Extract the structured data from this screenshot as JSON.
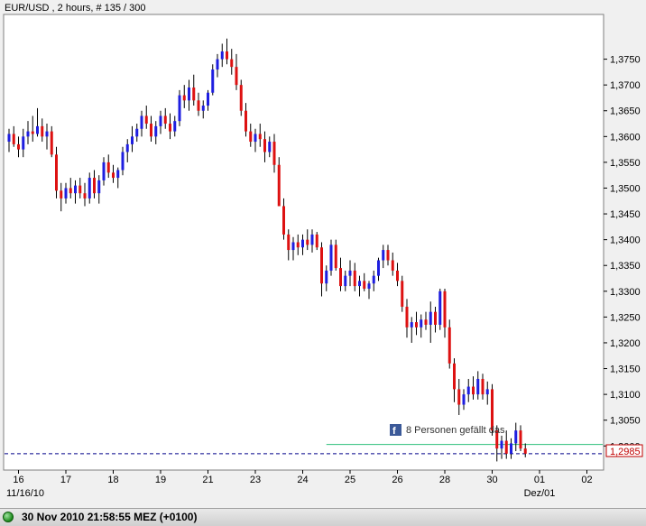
{
  "chart_data": {
    "type": "candlestick",
    "title": "EUR/USD , 2 hours, # 135 / 300",
    "y_ticks": [
      "1,2985",
      "1,3000",
      "1,3050",
      "1,3100",
      "1,3150",
      "1,3200",
      "1,3250",
      "1,3300",
      "1,3350",
      "1,3400",
      "1,3450",
      "1,3500",
      "1,3550",
      "1,3600",
      "1,3650",
      "1,3700",
      "1,3750"
    ],
    "ylim": [
      1.2955,
      1.3835
    ],
    "x_ticks": [
      {
        "label": "16",
        "bar": 2
      },
      {
        "label": "17",
        "bar": 12
      },
      {
        "label": "18",
        "bar": 22
      },
      {
        "label": "19",
        "bar": 32
      },
      {
        "label": "21",
        "bar": 42
      },
      {
        "label": "23",
        "bar": 52
      },
      {
        "label": "24",
        "bar": 62
      },
      {
        "label": "25",
        "bar": 72
      },
      {
        "label": "26",
        "bar": 82
      },
      {
        "label": "28",
        "bar": 92
      },
      {
        "label": "30",
        "bar": 102
      },
      {
        "label": "01",
        "bar": 112
      },
      {
        "label": "02",
        "bar": 122
      }
    ],
    "x_sub_labels": [
      "11/16/10",
      "Dez/01"
    ],
    "last_price": 1.2985,
    "last_price_label": "1,2985",
    "hline": {
      "value": 1.3003,
      "from_bar": 67,
      "color": "#2bbf7a"
    },
    "colors": {
      "up": "#1e1ee0",
      "down": "#dd1111",
      "wick": "#000000",
      "grid_dash": "#00008b",
      "last_label": "#c00000"
    },
    "candles": [
      [
        1.359,
        1.3615,
        1.357,
        1.3605
      ],
      [
        1.3605,
        1.362,
        1.358,
        1.3585
      ],
      [
        1.3585,
        1.36,
        1.356,
        1.3575
      ],
      [
        1.3575,
        1.3615,
        1.356,
        1.36
      ],
      [
        1.36,
        1.363,
        1.3585,
        1.361
      ],
      [
        1.361,
        1.364,
        1.359,
        1.3605
      ],
      [
        1.3605,
        1.3655,
        1.36,
        1.362
      ],
      [
        1.362,
        1.3635,
        1.359,
        1.36
      ],
      [
        1.36,
        1.3625,
        1.3575,
        1.361
      ],
      [
        1.361,
        1.362,
        1.356,
        1.3565
      ],
      [
        1.3565,
        1.358,
        1.348,
        1.3495
      ],
      [
        1.3495,
        1.351,
        1.3455,
        1.348
      ],
      [
        1.348,
        1.351,
        1.347,
        1.35
      ],
      [
        1.35,
        1.352,
        1.348,
        1.349
      ],
      [
        1.349,
        1.3515,
        1.347,
        1.3505
      ],
      [
        1.3505,
        1.352,
        1.348,
        1.349
      ],
      [
        1.349,
        1.351,
        1.3465,
        1.348
      ],
      [
        1.348,
        1.353,
        1.347,
        1.352
      ],
      [
        1.352,
        1.3535,
        1.348,
        1.349
      ],
      [
        1.349,
        1.3525,
        1.347,
        1.3515
      ],
      [
        1.3515,
        1.356,
        1.3505,
        1.355
      ],
      [
        1.355,
        1.3565,
        1.352,
        1.353
      ],
      [
        1.353,
        1.3545,
        1.351,
        1.352
      ],
      [
        1.352,
        1.354,
        1.35,
        1.3535
      ],
      [
        1.3535,
        1.358,
        1.3525,
        1.357
      ],
      [
        1.357,
        1.3595,
        1.355,
        1.3585
      ],
      [
        1.3585,
        1.362,
        1.357,
        1.36
      ],
      [
        1.36,
        1.3625,
        1.359,
        1.3615
      ],
      [
        1.3615,
        1.365,
        1.36,
        1.364
      ],
      [
        1.364,
        1.366,
        1.3615,
        1.3625
      ],
      [
        1.3625,
        1.364,
        1.359,
        1.36
      ],
      [
        1.36,
        1.363,
        1.3585,
        1.362
      ],
      [
        1.362,
        1.365,
        1.3605,
        1.364
      ],
      [
        1.364,
        1.3655,
        1.3615,
        1.3625
      ],
      [
        1.3625,
        1.3645,
        1.3595,
        1.361
      ],
      [
        1.361,
        1.364,
        1.36,
        1.363
      ],
      [
        1.363,
        1.369,
        1.362,
        1.368
      ],
      [
        1.368,
        1.37,
        1.3655,
        1.367
      ],
      [
        1.367,
        1.371,
        1.365,
        1.3695
      ],
      [
        1.3695,
        1.372,
        1.366,
        1.367
      ],
      [
        1.367,
        1.3685,
        1.364,
        1.365
      ],
      [
        1.365,
        1.367,
        1.3635,
        1.366
      ],
      [
        1.366,
        1.369,
        1.365,
        1.3685
      ],
      [
        1.3685,
        1.374,
        1.368,
        1.373
      ],
      [
        1.373,
        1.376,
        1.3715,
        1.375
      ],
      [
        1.375,
        1.378,
        1.3735,
        1.3765
      ],
      [
        1.3765,
        1.379,
        1.374,
        1.375
      ],
      [
        1.375,
        1.377,
        1.372,
        1.3735
      ],
      [
        1.3735,
        1.376,
        1.369,
        1.37
      ],
      [
        1.37,
        1.371,
        1.364,
        1.365
      ],
      [
        1.365,
        1.3665,
        1.36,
        1.361
      ],
      [
        1.361,
        1.3625,
        1.358,
        1.359
      ],
      [
        1.359,
        1.3615,
        1.357,
        1.3605
      ],
      [
        1.3605,
        1.3625,
        1.358,
        1.3595
      ],
      [
        1.3595,
        1.361,
        1.355,
        1.357
      ],
      [
        1.357,
        1.36,
        1.356,
        1.359
      ],
      [
        1.359,
        1.3605,
        1.353,
        1.3545
      ],
      [
        1.3545,
        1.356,
        1.348,
        1.3465
      ],
      [
        1.3465,
        1.348,
        1.34,
        1.341
      ],
      [
        1.341,
        1.342,
        1.336,
        1.338
      ],
      [
        1.338,
        1.3405,
        1.336,
        1.3395
      ],
      [
        1.3395,
        1.341,
        1.337,
        1.3385
      ],
      [
        1.3385,
        1.341,
        1.337,
        1.34
      ],
      [
        1.34,
        1.342,
        1.338,
        1.339
      ],
      [
        1.339,
        1.342,
        1.3375,
        1.341
      ],
      [
        1.341,
        1.3415,
        1.338,
        1.3385
      ],
      [
        1.3385,
        1.3395,
        1.329,
        1.3315
      ],
      [
        1.3315,
        1.335,
        1.33,
        1.334
      ],
      [
        1.334,
        1.34,
        1.333,
        1.339
      ],
      [
        1.339,
        1.34,
        1.334,
        1.3345
      ],
      [
        1.3345,
        1.3365,
        1.33,
        1.331
      ],
      [
        1.331,
        1.334,
        1.33,
        1.333
      ],
      [
        1.333,
        1.336,
        1.331,
        1.334
      ],
      [
        1.334,
        1.3355,
        1.33,
        1.331
      ],
      [
        1.331,
        1.333,
        1.329,
        1.332
      ],
      [
        1.332,
        1.3335,
        1.33,
        1.3305
      ],
      [
        1.3305,
        1.332,
        1.3285,
        1.3315
      ],
      [
        1.3315,
        1.334,
        1.33,
        1.333
      ],
      [
        1.333,
        1.3365,
        1.332,
        1.336
      ],
      [
        1.336,
        1.339,
        1.3345,
        1.338
      ],
      [
        1.338,
        1.339,
        1.335,
        1.336
      ],
      [
        1.336,
        1.3375,
        1.333,
        1.334
      ],
      [
        1.334,
        1.3355,
        1.331,
        1.332
      ],
      [
        1.332,
        1.333,
        1.326,
        1.327
      ],
      [
        1.327,
        1.3285,
        1.321,
        1.323
      ],
      [
        1.323,
        1.325,
        1.32,
        1.324
      ],
      [
        1.324,
        1.326,
        1.3215,
        1.323
      ],
      [
        1.323,
        1.3255,
        1.321,
        1.3245
      ],
      [
        1.3245,
        1.326,
        1.3225,
        1.3235
      ],
      [
        1.3235,
        1.328,
        1.32,
        1.326
      ],
      [
        1.326,
        1.327,
        1.322,
        1.3235
      ],
      [
        1.3235,
        1.3305,
        1.3225,
        1.33
      ],
      [
        1.33,
        1.3305,
        1.321,
        1.323
      ],
      [
        1.323,
        1.3245,
        1.315,
        1.316
      ],
      [
        1.316,
        1.317,
        1.3085,
        1.311
      ],
      [
        1.311,
        1.313,
        1.306,
        1.308
      ],
      [
        1.308,
        1.311,
        1.307,
        1.31
      ],
      [
        1.31,
        1.313,
        1.3085,
        1.3115
      ],
      [
        1.3115,
        1.3135,
        1.309,
        1.31
      ],
      [
        1.31,
        1.3145,
        1.309,
        1.313
      ],
      [
        1.313,
        1.314,
        1.309,
        1.31
      ],
      [
        1.31,
        1.3125,
        1.308,
        1.311
      ],
      [
        1.311,
        1.312,
        1.302,
        1.303
      ],
      [
        1.303,
        1.304,
        1.297,
        1.2995
      ],
      [
        1.2995,
        1.302,
        1.2975,
        1.301
      ],
      [
        1.301,
        1.303,
        1.2975,
        1.2985
      ],
      [
        1.2985,
        1.3015,
        1.2975,
        1.3005
      ],
      [
        1.3005,
        1.3045,
        1.299,
        1.303
      ],
      [
        1.303,
        1.304,
        1.299,
        1.2995
      ],
      [
        1.2995,
        1.3005,
        1.2978,
        1.2985
      ]
    ]
  },
  "facebook": {
    "icon": "facebook-icon",
    "text": "8 Personen gefällt das."
  },
  "status": {
    "text": "30 Nov 2010 21:58:55  MEZ (+0100)",
    "indicator_color": "#1a8a1a"
  }
}
